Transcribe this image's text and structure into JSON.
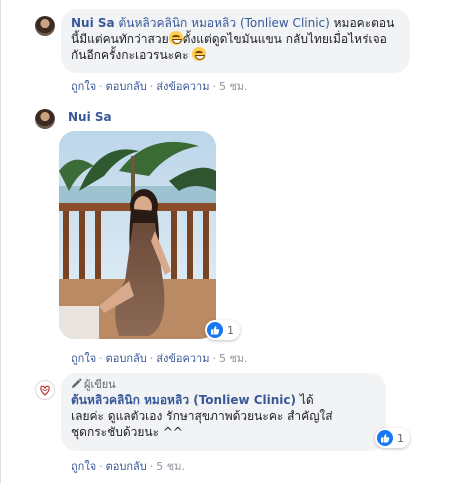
{
  "comment1": {
    "author": "Nui Sa",
    "author_inline": "ต้นหลิวคลินิก หมอหลิว (Tonliew Clinic)",
    "text_part1": " หมอคะตอนนี้มีแต่คนทักว่าสวย",
    "text_part2": "ตั้งแต่ดูดไขมันแขน กลับไทยเมื่อไหร่เจอกันอีกครั้งกะเอวรนะคะ",
    "actions": {
      "like": "ถูกใจ",
      "reply": "ตอบกลับ",
      "message": "ส่งข้อความ",
      "time": "5 ชม."
    }
  },
  "comment2": {
    "author": "Nui Sa",
    "reaction_count": "1",
    "actions": {
      "like": "ถูกใจ",
      "reply": "ตอบกลับ",
      "message": "ส่งข้อความ",
      "time": "5 ชม."
    }
  },
  "comment3": {
    "badge": "ผู้เขียน",
    "author": "ต้นหลิวคลินิก หมอหลิว (Tonliew Clinic)",
    "text_after_author": " ได้",
    "text_line2": "เลยค่ะ ดูแลตัวเอง รักษาสุขภาพด้วยนะคะ สำคัญใส่",
    "text_line3": "ชุดกระชับด้วยนะ ^^",
    "reaction_count": "1",
    "actions": {
      "like": "ถูกใจ",
      "reply": "ตอบกลับ",
      "time": "5 ชม."
    }
  },
  "colors": {
    "link": "#385898",
    "bubble": "#f2f3f5",
    "meta": "#90949c",
    "like": "#1877f2"
  },
  "icons": [
    "avatar",
    "smile-emoji-icon",
    "like-icon",
    "pen-icon",
    "clinic-logo-icon"
  ]
}
